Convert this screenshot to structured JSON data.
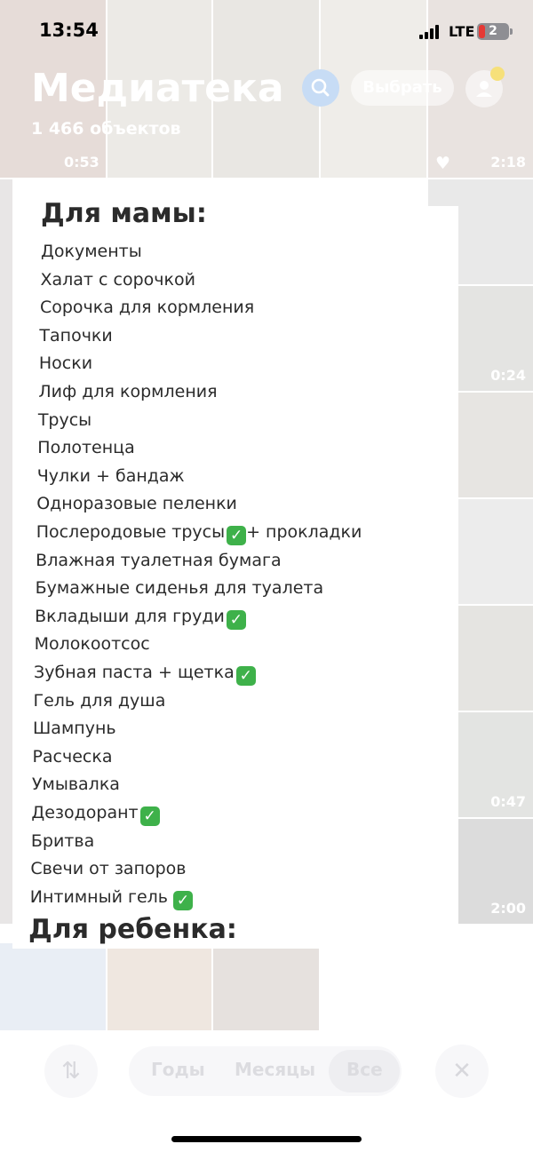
{
  "status_bar": {
    "time": "13:54",
    "carrier": "LTE",
    "battery_level": "2"
  },
  "library": {
    "title": "Медиатека",
    "count": "1 466 объектов",
    "select_label": "Выбрать",
    "durations": [
      "0:53",
      "2:18",
      "0:24",
      "0:47",
      "2:00"
    ]
  },
  "toolbar": {
    "segments": [
      "Годы",
      "Месяцы",
      "Все"
    ],
    "active_segment": "Все"
  },
  "note": {
    "mom_heading": "Для мамы:",
    "items": [
      {
        "text": "Документы",
        "checked": false
      },
      {
        "text": "Халат с сорочкой",
        "checked": false
      },
      {
        "text": "Сорочка для кормления",
        "checked": false
      },
      {
        "text": "Тапочки",
        "checked": false
      },
      {
        "text": "Носки",
        "checked": false
      },
      {
        "text": "Лиф для кормления",
        "checked": false
      },
      {
        "text": "Трусы",
        "checked": false
      },
      {
        "text": "Полотенца",
        "checked": false
      },
      {
        "text": "Чулки + бандаж",
        "checked": false
      },
      {
        "text": "Одноразовые пеленки",
        "checked": false
      },
      {
        "text": "Послеродовые трусы",
        "checked": true,
        "suffix": "+ прокладки"
      },
      {
        "text": "Влажная туалетная бумага",
        "checked": false
      },
      {
        "text": "Бумажные сиденья для туалета",
        "checked": false
      },
      {
        "text": "Вкладыши для груди",
        "checked": true
      },
      {
        "text": "Молокоотсос",
        "checked": false
      },
      {
        "text": "Зубная паста + щетка",
        "checked": true
      },
      {
        "text": "Гель для душа",
        "checked": false
      },
      {
        "text": "Шампунь",
        "checked": false
      },
      {
        "text": "Расческа",
        "checked": false
      },
      {
        "text": "Умывалка",
        "checked": false
      },
      {
        "text": "Дезодорант",
        "checked": true
      },
      {
        "text": "Бритва",
        "checked": false
      },
      {
        "text": "Свечи от запоров",
        "checked": false
      },
      {
        "text": "Интимный гель",
        "checked": true
      }
    ],
    "child_heading": "Для ребенка:"
  },
  "colors": {
    "check": "#3eb14a",
    "battery_low": "#e53935",
    "search_accent": "#c7dcf5"
  },
  "icons": [
    "heart-icon",
    "search-icon",
    "profile-icon",
    "sort-icon",
    "close-icon",
    "check-icon"
  ]
}
